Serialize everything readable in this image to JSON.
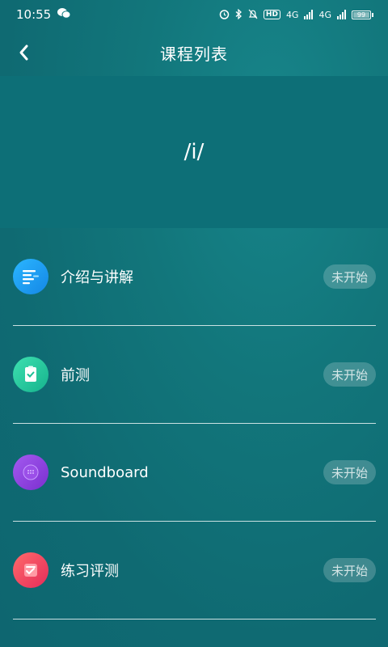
{
  "status_bar": {
    "time": "10:55",
    "net1": "4G",
    "net2": "4G",
    "hd": "HD",
    "battery_level": "99"
  },
  "header": {
    "title": "课程列表",
    "back_icon": "chevron-left-icon"
  },
  "hero": {
    "phoneme": "/i/"
  },
  "lessons": [
    {
      "label": "介绍与讲解",
      "status": "未开始",
      "icon": "document-lines-icon",
      "icon_color": "#1b9ff0"
    },
    {
      "label": "前测",
      "status": "未开始",
      "icon": "clipboard-check-icon",
      "icon_color": "#25c9a0"
    },
    {
      "label": "Soundboard",
      "status": "未开始",
      "icon": "speaker-grid-icon",
      "icon_color": "#8b3fd9"
    },
    {
      "label": "练习评测",
      "status": "未开始",
      "icon": "practice-card-icon",
      "icon_color": "#f0455e"
    }
  ],
  "colors": {
    "background": "#12767b",
    "hero_background": "#0d6f77",
    "text": "#ffffff"
  }
}
